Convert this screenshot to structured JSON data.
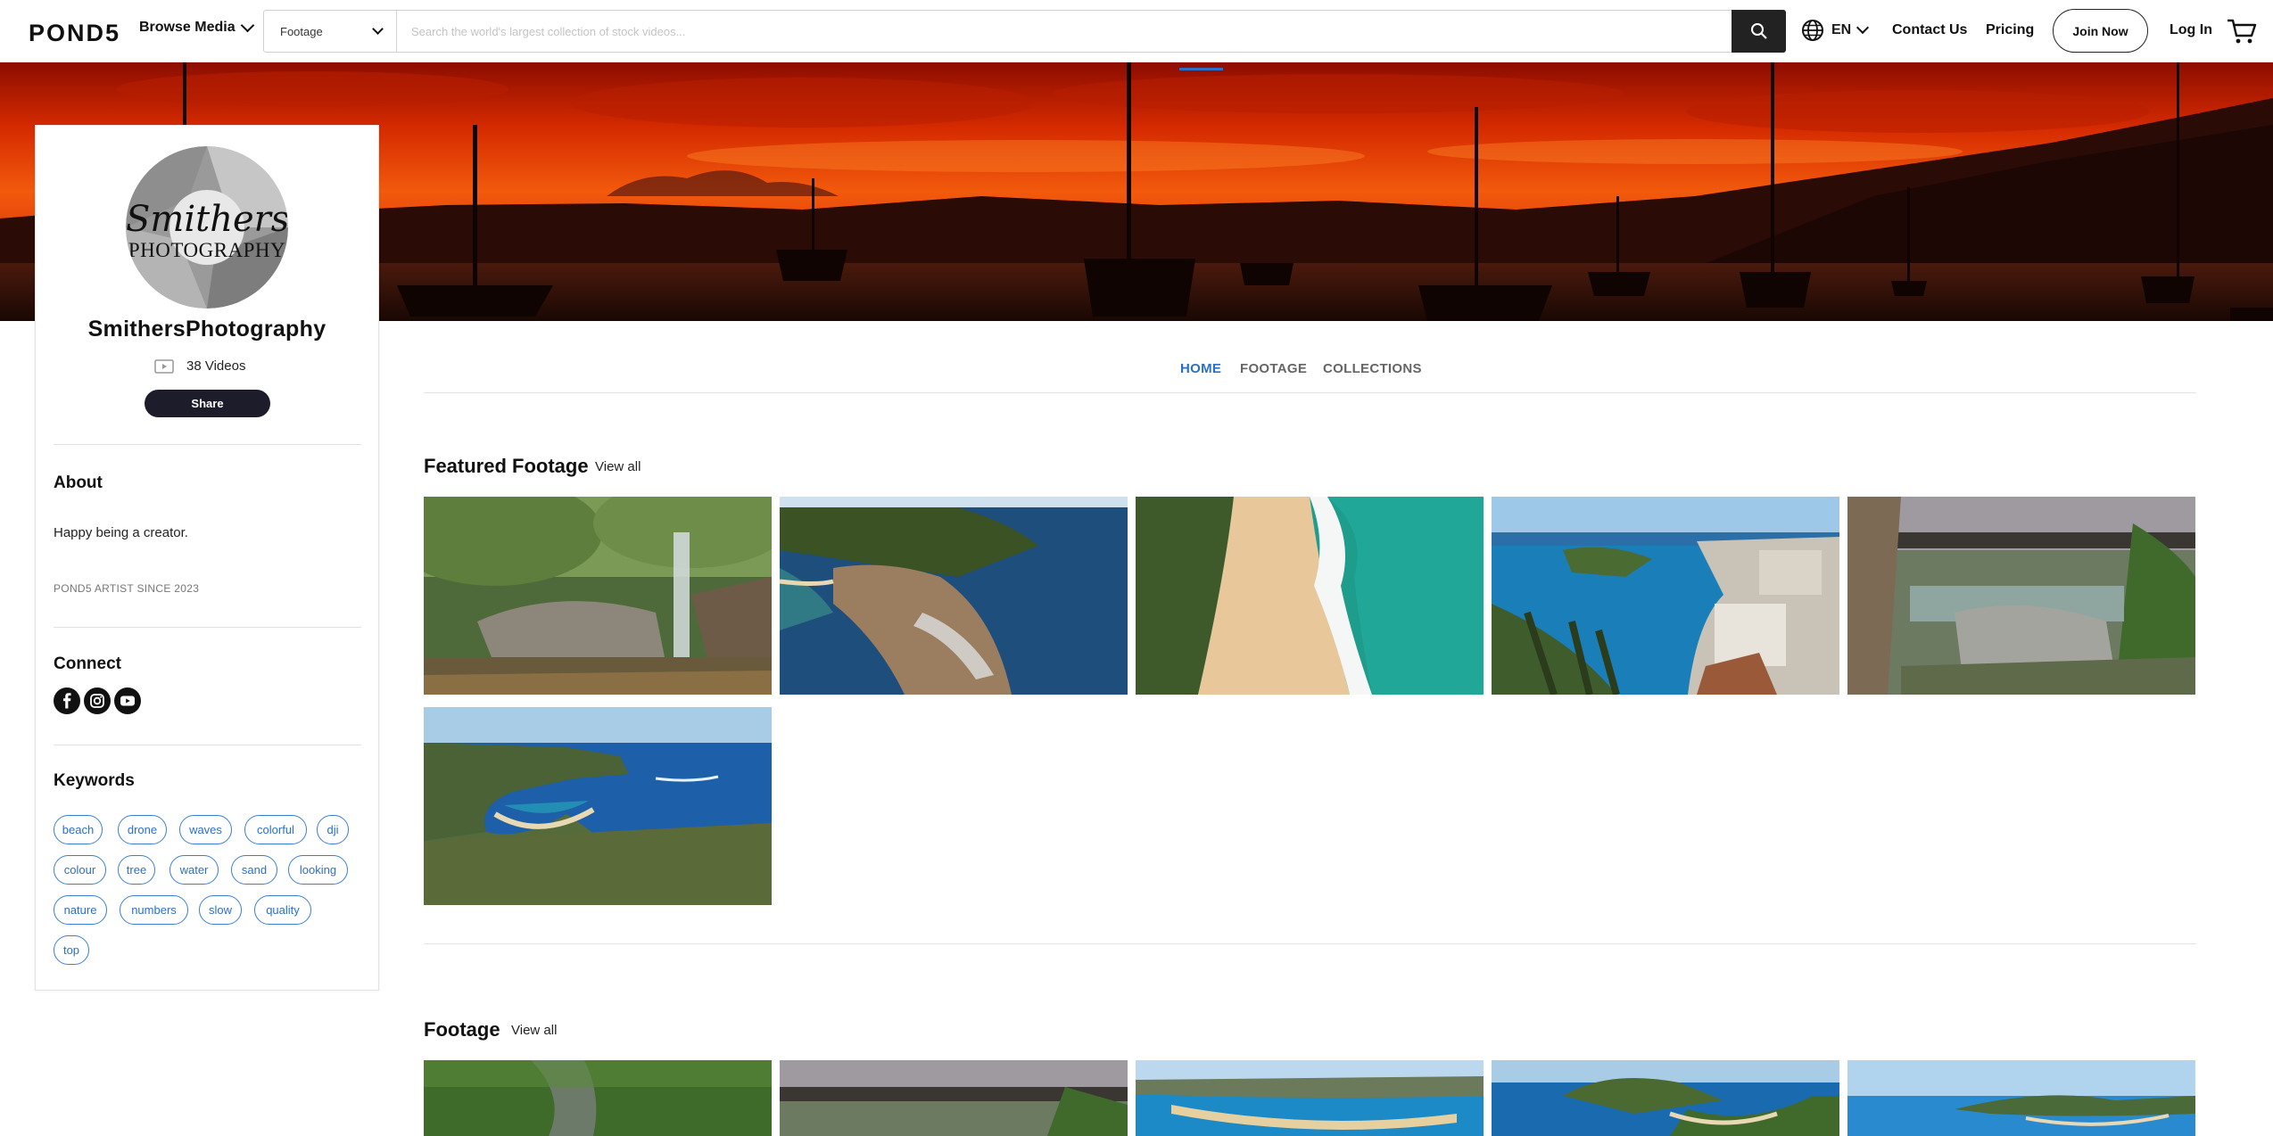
{
  "header": {
    "logo": "POND5",
    "browse_label": "Browse Media",
    "search_category": "Footage",
    "search_placeholder": "Search the world's largest collection of stock videos...",
    "language": "EN",
    "contact_label": "Contact Us",
    "pricing_label": "Pricing",
    "join_label": "Join Now",
    "login_label": "Log In"
  },
  "profile": {
    "avatar_text_line1": "Smithers",
    "avatar_text_line2": "PHOTOGRAPHY",
    "name": "SmithersPhotography",
    "videos_label": "38 Videos",
    "share_label": "Share",
    "about_title": "About",
    "about_text": "Happy being a creator.",
    "since_text": "POND5 ARTIST SINCE 2023",
    "connect_title": "Connect",
    "socials": [
      "facebook-icon",
      "instagram-icon",
      "youtube-icon"
    ],
    "keywords_title": "Keywords",
    "keywords": [
      "beach",
      "drone",
      "waves",
      "colorful",
      "dji",
      "colour",
      "tree",
      "water",
      "sand",
      "looking",
      "nature",
      "numbers",
      "slow",
      "quality",
      "top"
    ]
  },
  "tabs": {
    "home": "HOME",
    "footage": "FOOTAGE",
    "collections": "COLLECTIONS"
  },
  "featured": {
    "title": "Featured Footage",
    "view_all": "View all"
  },
  "footage": {
    "title": "Footage",
    "view_all": "View all"
  },
  "colors": {
    "accent": "#2a70c8",
    "dark_button": "#1c1c2a",
    "search_button": "#222222"
  }
}
